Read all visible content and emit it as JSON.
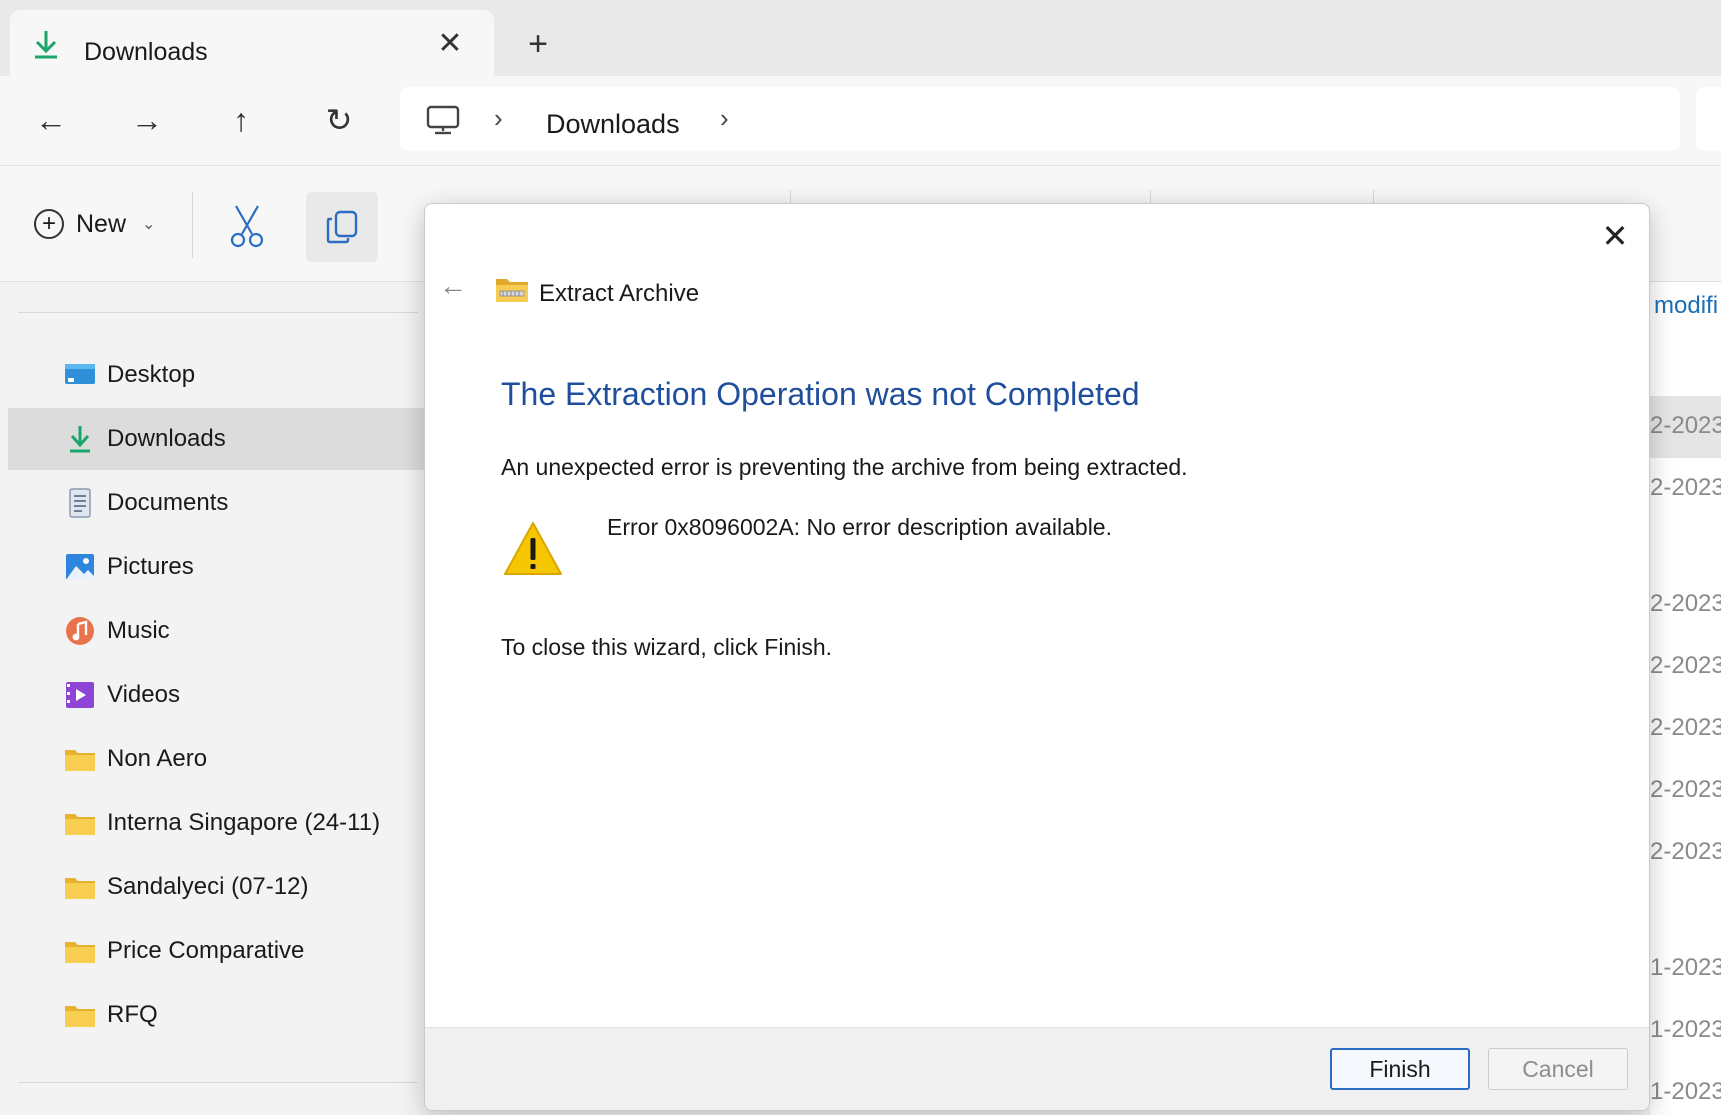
{
  "window": {
    "tab_title": "Downloads",
    "tab_close_glyph": "✕",
    "new_tab_glyph": "+"
  },
  "nav": {
    "back_glyph": "←",
    "forward_glyph": "→",
    "up_glyph": "↑",
    "refresh_glyph": "↻",
    "breadcrumb": [
      "Downloads"
    ],
    "breadcrumb_sep": "›"
  },
  "toolbar": {
    "new_label": "New",
    "new_chevron": "⌄"
  },
  "sidebar": {
    "items": [
      {
        "label": "Desktop",
        "icon": "desktop-icon"
      },
      {
        "label": "Downloads",
        "icon": "download-icon",
        "selected": true
      },
      {
        "label": "Documents",
        "icon": "documents-icon"
      },
      {
        "label": "Pictures",
        "icon": "pictures-icon"
      },
      {
        "label": "Music",
        "icon": "music-icon"
      },
      {
        "label": "Videos",
        "icon": "videos-icon"
      },
      {
        "label": "Non Aero",
        "icon": "folder-icon"
      },
      {
        "label": "Interna Singapore (24-11)",
        "icon": "folder-icon"
      },
      {
        "label": "Sandalyeci (07-12)",
        "icon": "folder-icon"
      },
      {
        "label": "Price Comparative",
        "icon": "folder-icon"
      },
      {
        "label": "RFQ",
        "icon": "folder-icon"
      }
    ]
  },
  "filelist": {
    "column_header": "modifi",
    "dates": [
      "2-2023",
      "2-2023",
      "2-2023",
      "2-2023",
      "2-2023",
      "2-2023",
      "2-2023",
      "1-2023",
      "1-2023",
      "1-2023"
    ]
  },
  "dialog": {
    "close_glyph": "✕",
    "back_glyph": "←",
    "title": "Extract Archive",
    "heading": "The Extraction Operation was not Completed",
    "message": "An unexpected error is preventing the archive from being extracted.",
    "error": "Error 0x8096002A: No error description available.",
    "instruction": "To close this wizard, click Finish.",
    "finish_label": "Finish",
    "cancel_label": "Cancel"
  },
  "colors": {
    "heading_blue": "#1f4e9c",
    "accent_blue": "#2c6dc4",
    "download_green": "#1aa66a",
    "folder_yellow": "#f4c542",
    "warning_yellow": "#f6c700"
  }
}
